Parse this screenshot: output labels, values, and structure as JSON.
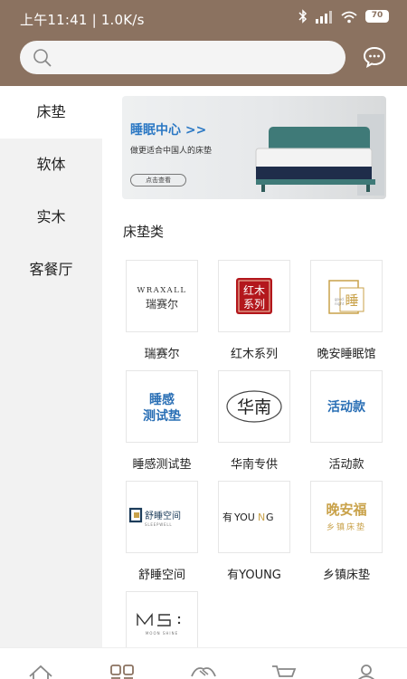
{
  "status": {
    "time": "上午11:41 | 1.0K/s",
    "battery": "70"
  },
  "search": {
    "placeholder": ""
  },
  "sidebar": {
    "items": [
      {
        "label": "床垫",
        "active": true
      },
      {
        "label": "软体",
        "active": false
      },
      {
        "label": "实木",
        "active": false
      },
      {
        "label": "客餐厅",
        "active": false
      }
    ]
  },
  "banner": {
    "title": "睡眠中心 >>",
    "subtitle": "做更适合中国人的床垫",
    "button": "点击查看"
  },
  "section": {
    "title": "床垫类"
  },
  "brands": [
    {
      "label": "瑞赛尔",
      "logo_top": "WRAXALL",
      "logo_bottom": "瑞赛尔"
    },
    {
      "label": "红木系列",
      "logo_top": "红木",
      "logo_bottom": "系列"
    },
    {
      "label": "晚安睡眠馆",
      "logo_top": "睡",
      "logo_bottom": "good night"
    },
    {
      "label": "睡感测试垫",
      "logo_top": "睡感",
      "logo_bottom": "测试垫"
    },
    {
      "label": "华南专供",
      "logo_top": "华南",
      "logo_bottom": ""
    },
    {
      "label": "活动款",
      "logo_top": "活动款",
      "logo_bottom": ""
    },
    {
      "label": "舒睡空间",
      "logo_top": "舒睡空间",
      "logo_bottom": "SLEEPWELL"
    },
    {
      "label": "有YOUNG",
      "logo_top": "有YOUNG",
      "logo_bottom": ""
    },
    {
      "label": "乡镇床垫",
      "logo_top": "晚安福",
      "logo_bottom": "乡镇床垫"
    },
    {
      "label": "",
      "logo_top": "MS",
      "logo_bottom": "MOON SHINE"
    }
  ],
  "colors": {
    "header_bg": "#8b7260",
    "banner_title": "#2b78c4",
    "redwood": "#b3171c",
    "brand_blue": "#2a6fb5",
    "gold": "#c9a24a"
  },
  "tabbar": {
    "icons": [
      "home-icon",
      "category-icon",
      "handshake-icon",
      "cart-icon",
      "profile-icon"
    ]
  }
}
